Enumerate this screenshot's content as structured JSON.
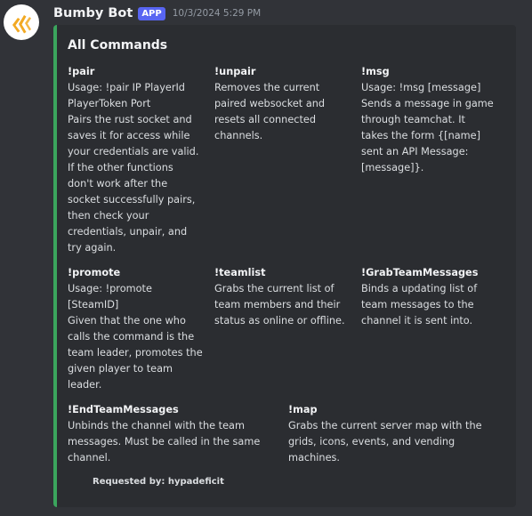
{
  "message": {
    "username": "Bumby Bot",
    "app_tag": "APP",
    "timestamp": "10/3/2024 5:29 PM",
    "avatar_icon": "orange-chevrons-logo",
    "accent_color": "#3ba55d"
  },
  "embed": {
    "title": "All Commands",
    "fields": [
      {
        "name": "!pair",
        "lines": [
          "Usage: !pair IP PlayerId",
          "PlayerToken Port",
          "Pairs the rust socket and",
          "saves it for access while",
          "your credentials are valid.",
          "If the other functions",
          "don't work after the",
          "socket successfully pairs,",
          "then check your",
          "credentials, unpair, and",
          "try again."
        ]
      },
      {
        "name": "!unpair",
        "lines": [
          "Removes the current",
          "paired websocket and",
          "resets all connected",
          "channels."
        ]
      },
      {
        "name": "!msg",
        "lines": [
          "Usage: !msg [message]",
          "Sends a message in game",
          "through teamchat. It",
          "takes the form {[name]",
          "sent an API Message:",
          "[message]}."
        ]
      },
      {
        "name": "!promote",
        "lines": [
          "Usage: !promote",
          "[SteamID]",
          "Given that the one who",
          "calls the command is the",
          "team leader, promotes the",
          "given player to team",
          "leader."
        ]
      },
      {
        "name": "!teamlist",
        "lines": [
          "Grabs the current list of",
          "team members and their",
          "status as online or offline."
        ]
      },
      {
        "name": "!GrabTeamMessages",
        "lines": [
          "Binds a updating list of",
          "team messages to the",
          "channel it is sent into."
        ]
      },
      {
        "name": "!EndTeamMessages",
        "lines": [
          "Unbinds the channel with the team",
          "messages. Must be called in the same",
          "channel."
        ]
      },
      {
        "name": "!map",
        "lines": [
          "Grabs the current server map with the",
          "grids, icons, events, and vending",
          "machines."
        ]
      }
    ],
    "footer": "Requested by: hypadeficit"
  }
}
